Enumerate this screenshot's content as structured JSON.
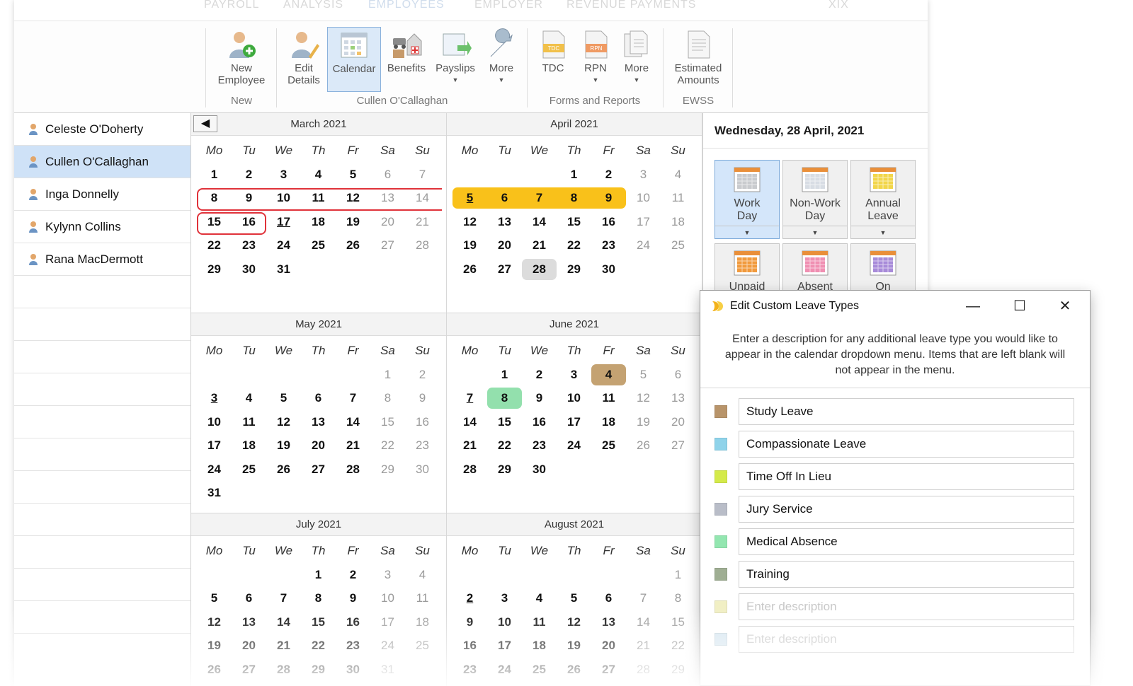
{
  "top_nav": [
    "PAYROLL",
    "ANALYSIS",
    "EMPLOYEES",
    "EMPLOYER",
    "REVENUE PAYMENTS",
    "XIX"
  ],
  "ribbon": {
    "new_employee": {
      "line1": "New",
      "line2": "Employee"
    },
    "edit_details": {
      "line1": "Edit",
      "line2": "Details"
    },
    "calendar": "Calendar",
    "benefits": "Benefits",
    "payslips": "Payslips",
    "more1": "More",
    "tdc": "TDC",
    "rpn": "RPN",
    "more2": "More",
    "estimated_amounts": {
      "line1": "Estimated",
      "line2": "Amounts"
    },
    "groups": {
      "new": "New",
      "employee": "Cullen O'Callaghan",
      "forms": "Forms and Reports",
      "ewss": "EWSS"
    },
    "tdc_badge": "TDC",
    "rpn_badge": "RPN"
  },
  "employees": [
    "Celeste O'Doherty",
    "Cullen O'Callaghan",
    "Inga Donnelly",
    "Kylynn Collins",
    "Rana MacDermott"
  ],
  "selected_employee": "Cullen O'Callaghan",
  "weekdays": [
    "Mo",
    "Tu",
    "We",
    "Th",
    "Fr",
    "Sa",
    "Su"
  ],
  "prev_arrow": "◀",
  "months": [
    {
      "title": "March 2021",
      "weeks": [
        [
          "1",
          "2",
          "3",
          "4",
          "5",
          "6",
          "7"
        ],
        [
          "8",
          "9",
          "10",
          "11",
          "12",
          "13",
          "14"
        ],
        [
          "15",
          "16",
          "17",
          "18",
          "19",
          "20",
          "21"
        ],
        [
          "22",
          "23",
          "24",
          "25",
          "26",
          "27",
          "28"
        ],
        [
          "29",
          "30",
          "31",
          "",
          "",
          "",
          ""
        ]
      ]
    },
    {
      "title": "April 2021",
      "weeks": [
        [
          "",
          "",
          "",
          "1",
          "2",
          "3",
          "4"
        ],
        [
          "5",
          "6",
          "7",
          "8",
          "9",
          "10",
          "11"
        ],
        [
          "12",
          "13",
          "14",
          "15",
          "16",
          "17",
          "18"
        ],
        [
          "19",
          "20",
          "21",
          "22",
          "23",
          "24",
          "25"
        ],
        [
          "26",
          "27",
          "28",
          "29",
          "30",
          "",
          ""
        ]
      ]
    },
    {
      "title": "May 2021",
      "weeks": [
        [
          "",
          "",
          "",
          "",
          "",
          "1",
          "2"
        ],
        [
          "3",
          "4",
          "5",
          "6",
          "7",
          "8",
          "9"
        ],
        [
          "10",
          "11",
          "12",
          "13",
          "14",
          "15",
          "16"
        ],
        [
          "17",
          "18",
          "19",
          "20",
          "21",
          "22",
          "23"
        ],
        [
          "24",
          "25",
          "26",
          "27",
          "28",
          "29",
          "30"
        ],
        [
          "31",
          "",
          "",
          "",
          "",
          "",
          ""
        ]
      ]
    },
    {
      "title": "June 2021",
      "weeks": [
        [
          "",
          "1",
          "2",
          "3",
          "4",
          "5",
          "6"
        ],
        [
          "7",
          "8",
          "9",
          "10",
          "11",
          "12",
          "13"
        ],
        [
          "14",
          "15",
          "16",
          "17",
          "18",
          "19",
          "20"
        ],
        [
          "21",
          "22",
          "23",
          "24",
          "25",
          "26",
          "27"
        ],
        [
          "28",
          "29",
          "30",
          "",
          "",
          "",
          ""
        ]
      ]
    },
    {
      "title": "July 2021",
      "weeks": [
        [
          "",
          "",
          "",
          "1",
          "2",
          "3",
          "4"
        ],
        [
          "5",
          "6",
          "7",
          "8",
          "9",
          "10",
          "11"
        ],
        [
          "12",
          "13",
          "14",
          "15",
          "16",
          "17",
          "18"
        ],
        [
          "19",
          "20",
          "21",
          "22",
          "23",
          "24",
          "25"
        ],
        [
          "26",
          "27",
          "28",
          "29",
          "30",
          "31",
          ""
        ]
      ]
    },
    {
      "title": "August 2021",
      "weeks": [
        [
          "",
          "",
          "",
          "",
          "",
          "",
          "1"
        ],
        [
          "2",
          "3",
          "4",
          "5",
          "6",
          "7",
          "8"
        ],
        [
          "9",
          "10",
          "11",
          "12",
          "13",
          "14",
          "15"
        ],
        [
          "16",
          "17",
          "18",
          "19",
          "20",
          "21",
          "22"
        ],
        [
          "23",
          "24",
          "25",
          "26",
          "27",
          "28",
          "29"
        ]
      ]
    }
  ],
  "highlights": {
    "april_annual_leave": [
      "5",
      "6",
      "7",
      "8",
      "9"
    ],
    "april_today": "28",
    "june_study_leave": "4",
    "june_medical": "8",
    "underlined": {
      "march": "17",
      "april": "5",
      "may": "3",
      "june": "7",
      "august": "2"
    }
  },
  "right_panel": {
    "date": "Wednesday, 28 April, 2021",
    "buttons": [
      {
        "line1": "Work",
        "line2": "Day"
      },
      {
        "line1": "Non-Work",
        "line2": "Day"
      },
      {
        "line1": "Annual",
        "line2": "Leave"
      },
      {
        "line1": "Unpaid",
        "line2": ""
      },
      {
        "line1": "Absent",
        "line2": ""
      },
      {
        "line1": "On",
        "line2": ""
      }
    ],
    "dropdown_arrow": "▼"
  },
  "dialog": {
    "title": "Edit Custom Leave Types",
    "minimize": "—",
    "maximize": "☐",
    "close": "✕",
    "description": "Enter a description for any additional leave type you would like to appear in the calendar dropdown menu. Items that are left blank will not appear in the menu.",
    "leave_types": [
      {
        "label": "Study Leave",
        "color": "#b8946a"
      },
      {
        "label": "Compassionate Leave",
        "color": "#8fd3ea"
      },
      {
        "label": "Time Off In Lieu",
        "color": "#d4ea4a"
      },
      {
        "label": "Jury Service",
        "color": "#b9bdc8"
      },
      {
        "label": "Medical Absence",
        "color": "#93e6b0"
      },
      {
        "label": "Training",
        "color": "#9fae93"
      }
    ],
    "placeholder": "Enter description",
    "blank_colors": [
      "#f1efc4",
      "#d6e6f0"
    ]
  }
}
